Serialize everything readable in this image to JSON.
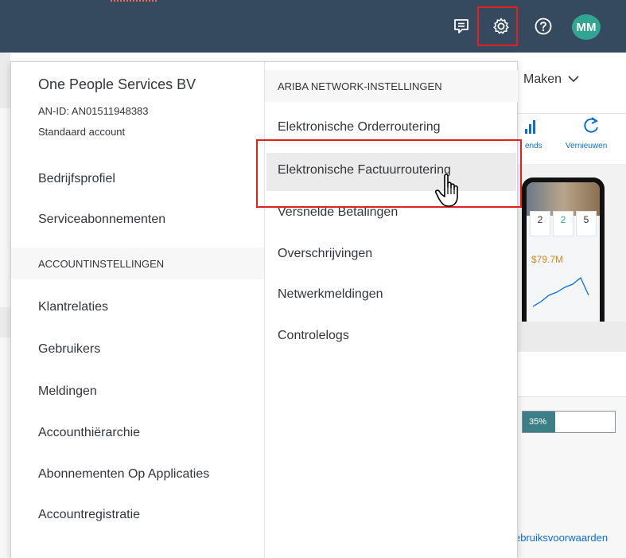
{
  "header": {
    "avatar_initials": "MM",
    "icons": [
      "feedback-icon",
      "gear-icon",
      "help-icon"
    ],
    "colors": {
      "bar": "#354a5f",
      "highlight": "#e0211d",
      "avatar": "#2fa592"
    }
  },
  "background_page": {
    "create_label": "Maken",
    "trends_label": "ends",
    "refresh_label": "Vernieuwen",
    "amount": "$79.7M",
    "tiles": [
      "2",
      "2",
      "5"
    ],
    "progress_label": "35%",
    "progress_value": 0.35,
    "terms_link": "ebruiksvoorwaarden"
  },
  "account": {
    "company_name": "One People Services BV",
    "an_id": "AN-ID: AN01511948383",
    "account_type": "Standaard account",
    "items": [
      {
        "label": "Bedrijfsprofiel"
      },
      {
        "label": "Serviceabonnementen"
      }
    ]
  },
  "account_settings": {
    "heading": "ACCOUNTINSTELLINGEN",
    "items": [
      {
        "label": "Klantrelaties"
      },
      {
        "label": "Gebruikers"
      },
      {
        "label": "Meldingen"
      },
      {
        "label": "Accounthiërarchie"
      },
      {
        "label": "Abonnementen Op Applicaties"
      },
      {
        "label": "Accountregistratie"
      }
    ]
  },
  "network_settings": {
    "heading": "ARIBA NETWORK-INSTELLINGEN",
    "items": [
      {
        "label": "Elektronische Orderroutering"
      },
      {
        "label": "Elektronische Factuurroutering"
      },
      {
        "label": "Versnelde Betalingen"
      },
      {
        "label": "Overschrijvingen"
      },
      {
        "label": "Netwerkmeldingen"
      },
      {
        "label": "Controlelogs"
      }
    ]
  }
}
